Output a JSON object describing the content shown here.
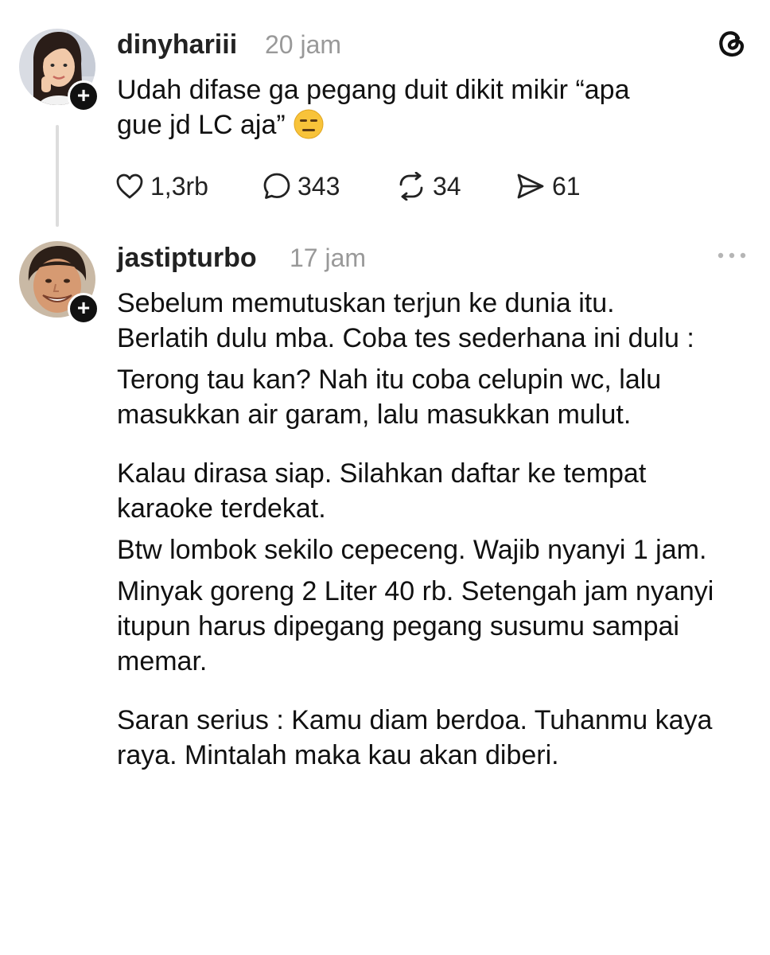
{
  "posts": [
    {
      "username": "dinyhariii",
      "time": "20 jam",
      "text_lines": [
        "Udah difase ga pegang duit dikit mikir “apa",
        "gue jd LC aja”"
      ],
      "emoji": "expressionless-face",
      "actions": {
        "likes": "1,3rb",
        "replies": "343",
        "reposts": "34",
        "shares": "61"
      }
    },
    {
      "username": "jastipturbo",
      "time": "17 jam",
      "paragraphs": [
        "Sebelum memutuskan terjun ke dunia itu.",
        "Berlatih dulu mba. Coba tes sederhana ini dulu :",
        "Terong tau kan? Nah itu coba celupin wc, lalu masukkan air garam, lalu masukkan mulut.",
        "Kalau dirasa siap. Silahkan daftar ke tempat karaoke terdekat.",
        "Btw lombok sekilo cepeceng. Wajib nyanyi 1 jam.",
        "Minyak goreng 2 Liter 40 rb. Setengah jam nyanyi itupun harus dipegang pegang susumu sampai memar.",
        "Saran serius : Kamu diam berdoa. Tuhanmu kaya raya. Mintalah maka kau akan diberi."
      ]
    }
  ],
  "icons": {
    "app_logo": "threads-logo-icon",
    "more": "more-dots-icon",
    "like": "heart-icon",
    "reply": "comment-icon",
    "repost": "repost-icon",
    "share": "send-icon",
    "follow": "plus-icon"
  },
  "colors": {
    "text": "#111111",
    "muted": "#999999",
    "thread_line": "#dddddd",
    "badge": "#111111"
  }
}
